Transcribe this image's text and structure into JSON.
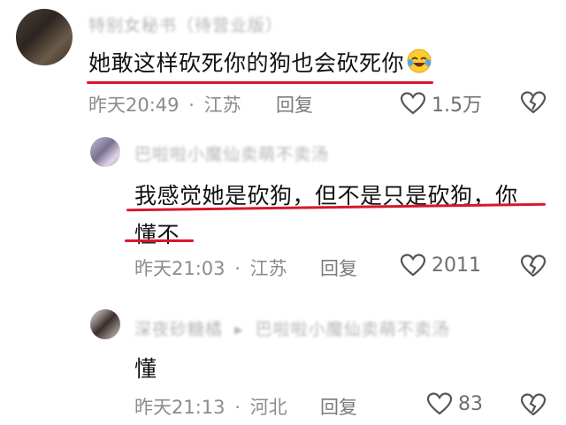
{
  "comments": [
    {
      "username": "特别女秘书（待营业版）",
      "text": "她敢这样砍死你的狗也会砍死你",
      "emoji_icon": "laughing-tears-emoji",
      "time": "昨天20:49",
      "location": "江苏",
      "reply_label": "回复",
      "likes": "1.5万"
    },
    {
      "username": "巴啦啦小魔仙卖萌不卖汤",
      "text_line1": "我感觉她是砍狗，但不是只是砍狗，你",
      "text_line2": "懂不",
      "time": "昨天21:03",
      "location": "江苏",
      "reply_label": "回复",
      "likes": "2011"
    },
    {
      "username": "深夜砂糖橘",
      "reply_to": "巴啦啦小魔仙卖萌不卖汤",
      "text": "懂",
      "time": "昨天21:13",
      "location": "河北",
      "reply_label": "回复",
      "likes": "83"
    }
  ],
  "separator": "·",
  "colors": {
    "underline": "#d8172b",
    "meta": "#8c8c8c",
    "username": "#b4b4b8"
  }
}
